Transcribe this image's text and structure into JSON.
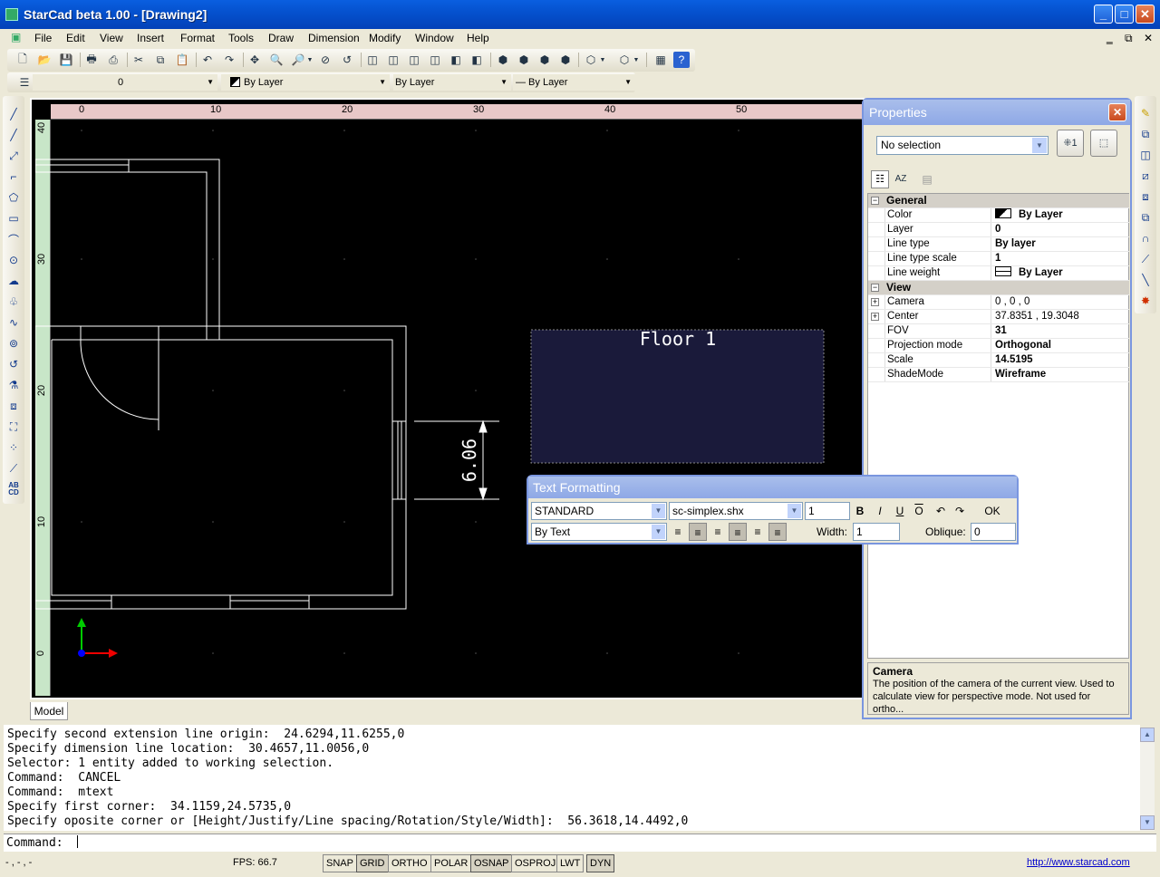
{
  "window": {
    "title": "StarCad beta 1.00 - [Drawing2]"
  },
  "menu": [
    "File",
    "Edit",
    "View",
    "Insert",
    "Format",
    "Tools",
    "Draw",
    "Dimension",
    "Modify",
    "Window",
    "Help"
  ],
  "layerbar": {
    "layer": "0",
    "color": "By Layer",
    "linetype": "By Layer",
    "lineweight": "— By Layer"
  },
  "ruler": {
    "h": [
      "0",
      "10",
      "20",
      "30",
      "40",
      "50"
    ],
    "v": [
      "40",
      "30",
      "20",
      "10",
      "0"
    ]
  },
  "drawing": {
    "floor_label": "Floor 1",
    "dimension": "6.06"
  },
  "model_tab": "Model",
  "properties": {
    "title": "Properties",
    "selection": "No selection",
    "categories": [
      {
        "name": "General",
        "rows": [
          {
            "k": "Color",
            "v": "By Layer"
          },
          {
            "k": "Layer",
            "v": "0"
          },
          {
            "k": "Line type",
            "v": "By layer"
          },
          {
            "k": "Line type scale",
            "v": "1"
          },
          {
            "k": "Line weight",
            "v": "By Layer"
          }
        ]
      },
      {
        "name": "View",
        "rows": [
          {
            "k": "Camera",
            "v": "0 , 0 , 0"
          },
          {
            "k": "Center",
            "v": "37.8351 , 19.3048"
          },
          {
            "k": "FOV",
            "v": "31"
          },
          {
            "k": "Projection mode",
            "v": "Orthogonal"
          },
          {
            "k": "Scale",
            "v": "14.5195"
          },
          {
            "k": "ShadeMode",
            "v": "Wireframe"
          }
        ]
      }
    ],
    "desc_title": "Camera",
    "desc_text": "The position of the camera of the current view. Used to calculate view for perspective mode. Not used for ortho..."
  },
  "textformat": {
    "title": "Text Formatting",
    "style": "STANDARD",
    "font": "sc-simplex.shx",
    "height": "1",
    "bold": "B",
    "italic": "I",
    "underline": "U",
    "overline": "O",
    "ok": "OK",
    "color": "By Text",
    "width_label": "Width:",
    "width": "1",
    "oblique_label": "Oblique:",
    "oblique": "0"
  },
  "history": [
    "Specify second extension line origin:  24.6294,11.6255,0",
    "Specify dimension line location:  30.4657,11.0056,0",
    "Selector: 1 entity added to working selection.",
    "Command:  CANCEL",
    "Command:  mtext",
    "Specify first corner:  34.1159,24.5735,0",
    "Specify oposite corner or [Height/Justify/Line spacing/Rotation/Style/Width]:  56.3618,14.4492,0"
  ],
  "command": {
    "prompt": "Command:"
  },
  "status": {
    "coords": "- , - , -",
    "fps": "FPS: 66.7",
    "buttons": [
      "SNAP",
      "GRID",
      "ORTHO",
      "POLAR",
      "OSNAP",
      "OSPROJ",
      "LWT",
      "DYN"
    ],
    "link": "http://www.starcad.com"
  }
}
